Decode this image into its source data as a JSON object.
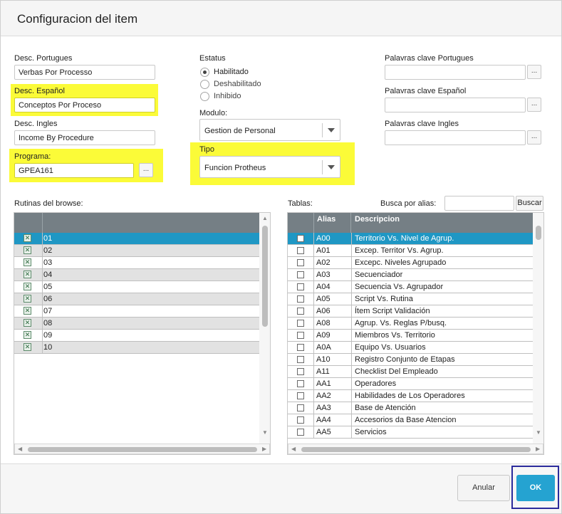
{
  "dialog": {
    "title": "Configuracion del item"
  },
  "fields": {
    "desc_portugues": {
      "label": "Desc. Portugues",
      "value": "Verbas Por Processo"
    },
    "desc_espanol": {
      "label": "Desc. Español",
      "value": "Conceptos Por Proceso"
    },
    "desc_ingles": {
      "label": "Desc. Ingles",
      "value": "Income By Procedure"
    },
    "programa": {
      "label": "Programa:",
      "value": "GPEA161",
      "lookup_label": "..."
    }
  },
  "estatus": {
    "label": "Estatus",
    "options": [
      "Habilitado",
      "Deshabilitado",
      "Inhibido"
    ],
    "selected": "Habilitado"
  },
  "modulo": {
    "label": "Modulo:",
    "value": "Gestion de Personal"
  },
  "tipo": {
    "label": "Tipo",
    "value": "Funcion Protheus"
  },
  "keywords": {
    "portugues": {
      "label": "Palavras clave Portugues",
      "value": ""
    },
    "espanol": {
      "label": "Palavras clave Español",
      "value": ""
    },
    "ingles": {
      "label": "Palavras clave Ingles",
      "value": ""
    },
    "lookup_label": "..."
  },
  "rutinas": {
    "label": "Rutinas del browse:",
    "rows": [
      {
        "value": "01",
        "checked": true
      },
      {
        "value": "02",
        "checked": true
      },
      {
        "value": "03",
        "checked": true
      },
      {
        "value": "04",
        "checked": true
      },
      {
        "value": "05",
        "checked": true
      },
      {
        "value": "06",
        "checked": true
      },
      {
        "value": "07",
        "checked": true
      },
      {
        "value": "08",
        "checked": true
      },
      {
        "value": "09",
        "checked": true
      },
      {
        "value": "10",
        "checked": true
      }
    ],
    "selected_index": 0
  },
  "tablas": {
    "label": "Tablas:",
    "search_label": "Busca por alias:",
    "search_value": "",
    "search_button": "Buscar",
    "columns": [
      "Alias",
      "Descripcion"
    ],
    "rows": [
      {
        "alias": "A00",
        "desc": "Territorio Vs. Nivel de Agrup."
      },
      {
        "alias": "A01",
        "desc": "Excep. Territor Vs. Agrup."
      },
      {
        "alias": "A02",
        "desc": "Excepc. Niveles Agrupado"
      },
      {
        "alias": "A03",
        "desc": "Secuenciador"
      },
      {
        "alias": "A04",
        "desc": "Secuencia Vs. Agrupador"
      },
      {
        "alias": "A05",
        "desc": "Script Vs. Rutina"
      },
      {
        "alias": "A06",
        "desc": "Ítem Script Validación"
      },
      {
        "alias": "A08",
        "desc": "Agrup. Vs. Reglas P/busq."
      },
      {
        "alias": "A09",
        "desc": "Miembros Vs. Territorio"
      },
      {
        "alias": "A0A",
        "desc": "Equipo Vs. Usuarios"
      },
      {
        "alias": "A10",
        "desc": "Registro Conjunto de Etapas"
      },
      {
        "alias": "A11",
        "desc": "Checklist Del Empleado"
      },
      {
        "alias": "AA1",
        "desc": "Operadores"
      },
      {
        "alias": "AA2",
        "desc": "Habilidades de Los Operadores"
      },
      {
        "alias": "AA3",
        "desc": "Base de Atención"
      },
      {
        "alias": "AA4",
        "desc": "Accesorios da Base Atencion"
      },
      {
        "alias": "AA5",
        "desc": "Servicios"
      }
    ],
    "selected_index": 0
  },
  "buttons": {
    "cancel": "Anular",
    "ok": "OK"
  },
  "colors": {
    "highlight": "#fbfb38",
    "selected_row": "#1f97c4",
    "header": "#757f85",
    "ok": "#25a3d1"
  }
}
